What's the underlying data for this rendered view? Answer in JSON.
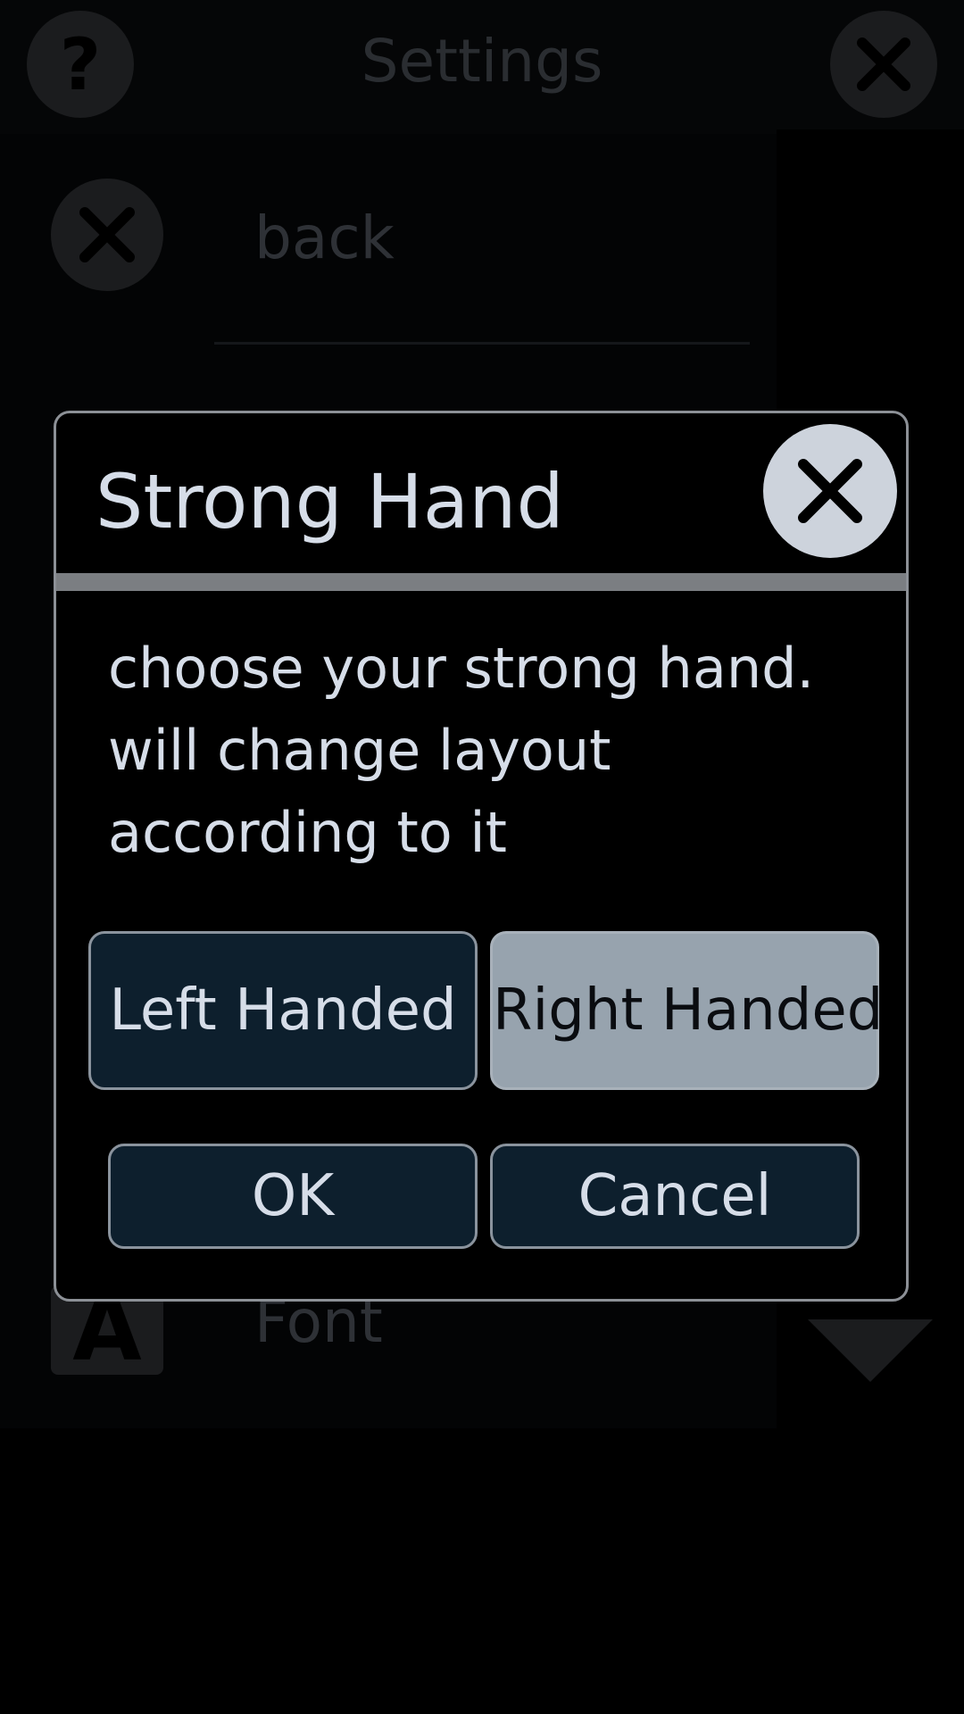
{
  "background": {
    "header_title": "Settings",
    "back_label": "back",
    "font_label": "Font",
    "font_icon_letter": "A"
  },
  "dialog": {
    "title": "Strong Hand",
    "message": "choose your strong hand. will change layout according to it",
    "options": {
      "left_label": "Left Handed",
      "right_label": "Right Handed",
      "selected": "Right Handed"
    },
    "ok_label": "OK",
    "cancel_label": "Cancel"
  },
  "colors": {
    "dialog_border": "#8c9096",
    "button_bg": "#0d1f2d",
    "selected_button_bg": "#97a3ae",
    "text": "#d6dde8"
  },
  "icons": [
    "help-icon",
    "close-icon",
    "font-icon",
    "arrow-down-icon"
  ]
}
